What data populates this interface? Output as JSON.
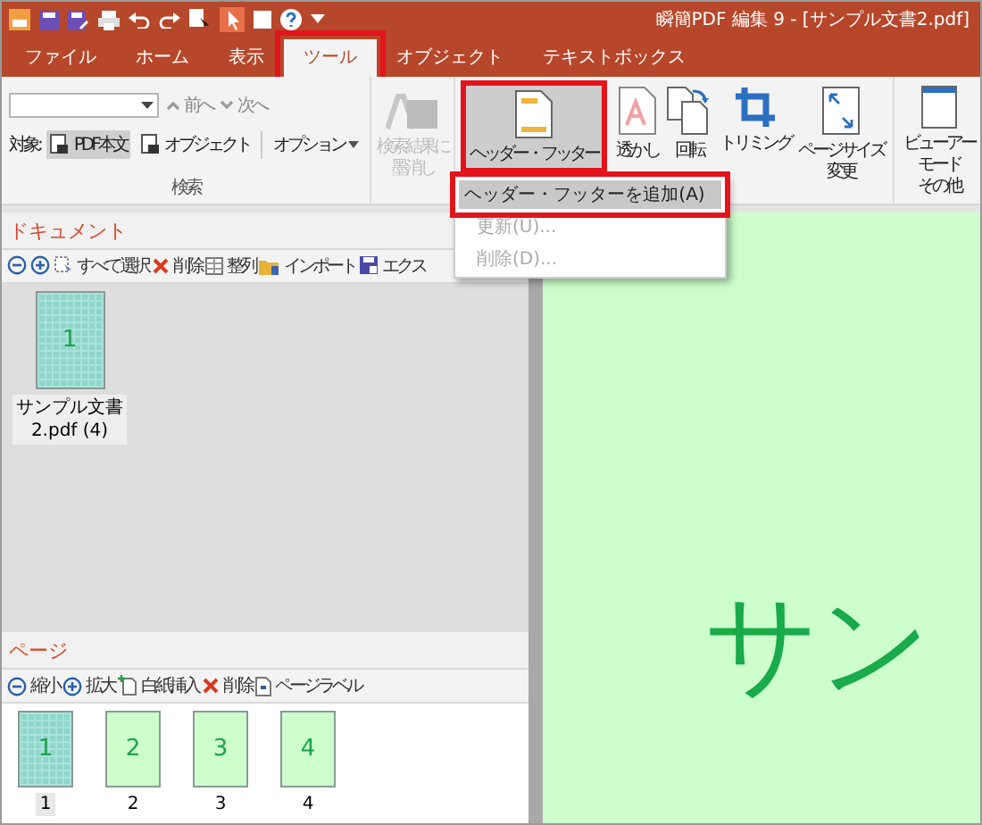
{
  "title_bar": {
    "title": "瞬簡PDF 編集 9 - [サンプル文書2.pdf]"
  },
  "tabs": [
    {
      "label": "ファイル",
      "selected": false,
      "annotated": false
    },
    {
      "label": "ホーム",
      "selected": false,
      "annotated": false
    },
    {
      "label": "表示",
      "selected": false,
      "annotated": false
    },
    {
      "label": "ツール",
      "selected": true,
      "annotated": true
    },
    {
      "label": "オブジェクト",
      "selected": false,
      "annotated": false
    },
    {
      "label": "テキストボックス",
      "selected": false,
      "annotated": false
    }
  ],
  "search_group": {
    "prev": "前へ",
    "next": "次へ",
    "target_label": "対象:",
    "targets": [
      {
        "label": "PDF本文",
        "selected": true
      },
      {
        "label": "オブジェクト",
        "selected": false
      }
    ],
    "options": "オプション",
    "label": "検索"
  },
  "redact": {
    "lines": [
      "検索結果に",
      "墨消し"
    ],
    "disabled": true
  },
  "tools": [
    {
      "kind": "header-footer",
      "lines": [
        "ヘッダー・フッター"
      ],
      "selected": true,
      "annotated": true
    },
    {
      "kind": "watermark",
      "lines": [
        "透かし"
      ],
      "selected": false,
      "annotated": false
    },
    {
      "kind": "rotate",
      "lines": [
        "回転"
      ],
      "selected": false,
      "annotated": false
    },
    {
      "kind": "crop",
      "lines": [
        "トリミング"
      ],
      "selected": false,
      "annotated": false
    },
    {
      "kind": "page-size",
      "lines": [
        "ページサイズ",
        "変更"
      ],
      "selected": false,
      "annotated": false
    }
  ],
  "viewer_button": {
    "lines": [
      "ビューアー",
      "モード",
      "その他"
    ]
  },
  "menu": {
    "items": [
      {
        "label": "ヘッダー・フッターを追加(A)",
        "selected": true,
        "disabled": false,
        "annotated": true
      },
      {
        "label": "更新(U)...",
        "selected": false,
        "disabled": true,
        "annotated": false
      },
      {
        "label": "削除(D)...",
        "selected": false,
        "disabled": true,
        "annotated": false
      }
    ]
  },
  "document_panel": {
    "title": "ドキュメント",
    "toolbar": [
      {
        "kind": "zoom-out"
      },
      {
        "kind": "zoom-in"
      },
      {
        "kind": "select-all",
        "label": "すべて選択"
      },
      {
        "kind": "delete",
        "label": "削除"
      },
      {
        "kind": "arrange",
        "label": "整列"
      },
      {
        "kind": "import",
        "label": "インポート"
      },
      {
        "kind": "export",
        "label": "エクス"
      }
    ],
    "files": [
      {
        "number": "1",
        "lines": [
          "サンプル文書",
          "2.pdf (4)"
        ],
        "selected": true
      }
    ]
  },
  "page_panel": {
    "title": "ページ",
    "toolbar": [
      {
        "kind": "zoom-out",
        "label": "縮小"
      },
      {
        "kind": "zoom-in",
        "label": "拡大"
      },
      {
        "kind": "insert-blank",
        "label": "白紙挿入"
      },
      {
        "kind": "delete",
        "label": "削除"
      },
      {
        "kind": "page-label",
        "label": "ページラベル"
      }
    ],
    "pages": [
      {
        "kind": "cover",
        "number": "1",
        "label": "1",
        "selected": true
      },
      {
        "kind": "plain",
        "number": "2",
        "label": "2",
        "selected": false
      },
      {
        "kind": "plain",
        "number": "3",
        "label": "3",
        "selected": false
      },
      {
        "kind": "plain",
        "number": "4",
        "label": "4",
        "selected": false
      }
    ]
  },
  "viewer": {
    "text": "サン"
  }
}
